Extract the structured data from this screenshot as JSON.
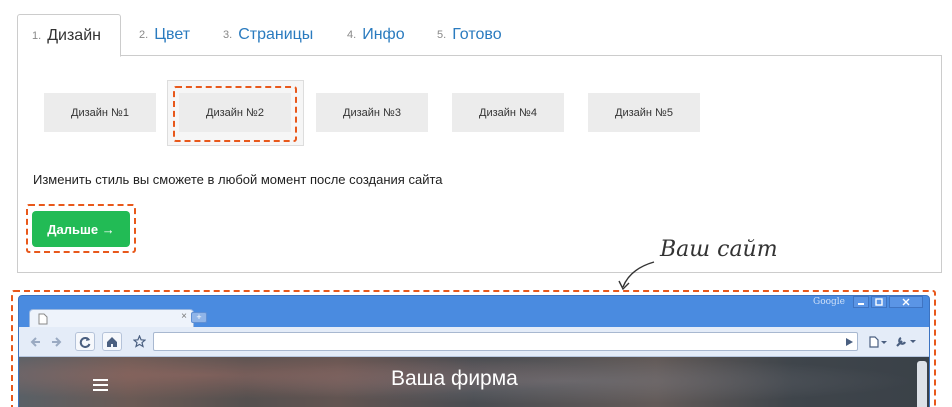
{
  "tabs": [
    {
      "num": "1.",
      "label": "Дизайн"
    },
    {
      "num": "2.",
      "label": "Цвет"
    },
    {
      "num": "3.",
      "label": "Страницы"
    },
    {
      "num": "4.",
      "label": "Инфо"
    },
    {
      "num": "5.",
      "label": "Готово"
    }
  ],
  "designs": [
    "Дизайн №1",
    "Дизайн №2",
    "Дизайн №3",
    "Дизайн №4",
    "Дизайн №5"
  ],
  "selected_design": "Дизайн №2",
  "hint": "Изменить стиль вы сможете в любой момент после создания сайта",
  "next_button": {
    "label": "Дальше →"
  },
  "annotation": "Ваш сайт",
  "browser": {
    "brand": "Google",
    "tab_close": "×",
    "new_tab": "+",
    "site_title": "Ваша фирма"
  },
  "colors": {
    "accent": "#e8581b",
    "button": "#22bb55",
    "link": "#2a7bbf"
  }
}
